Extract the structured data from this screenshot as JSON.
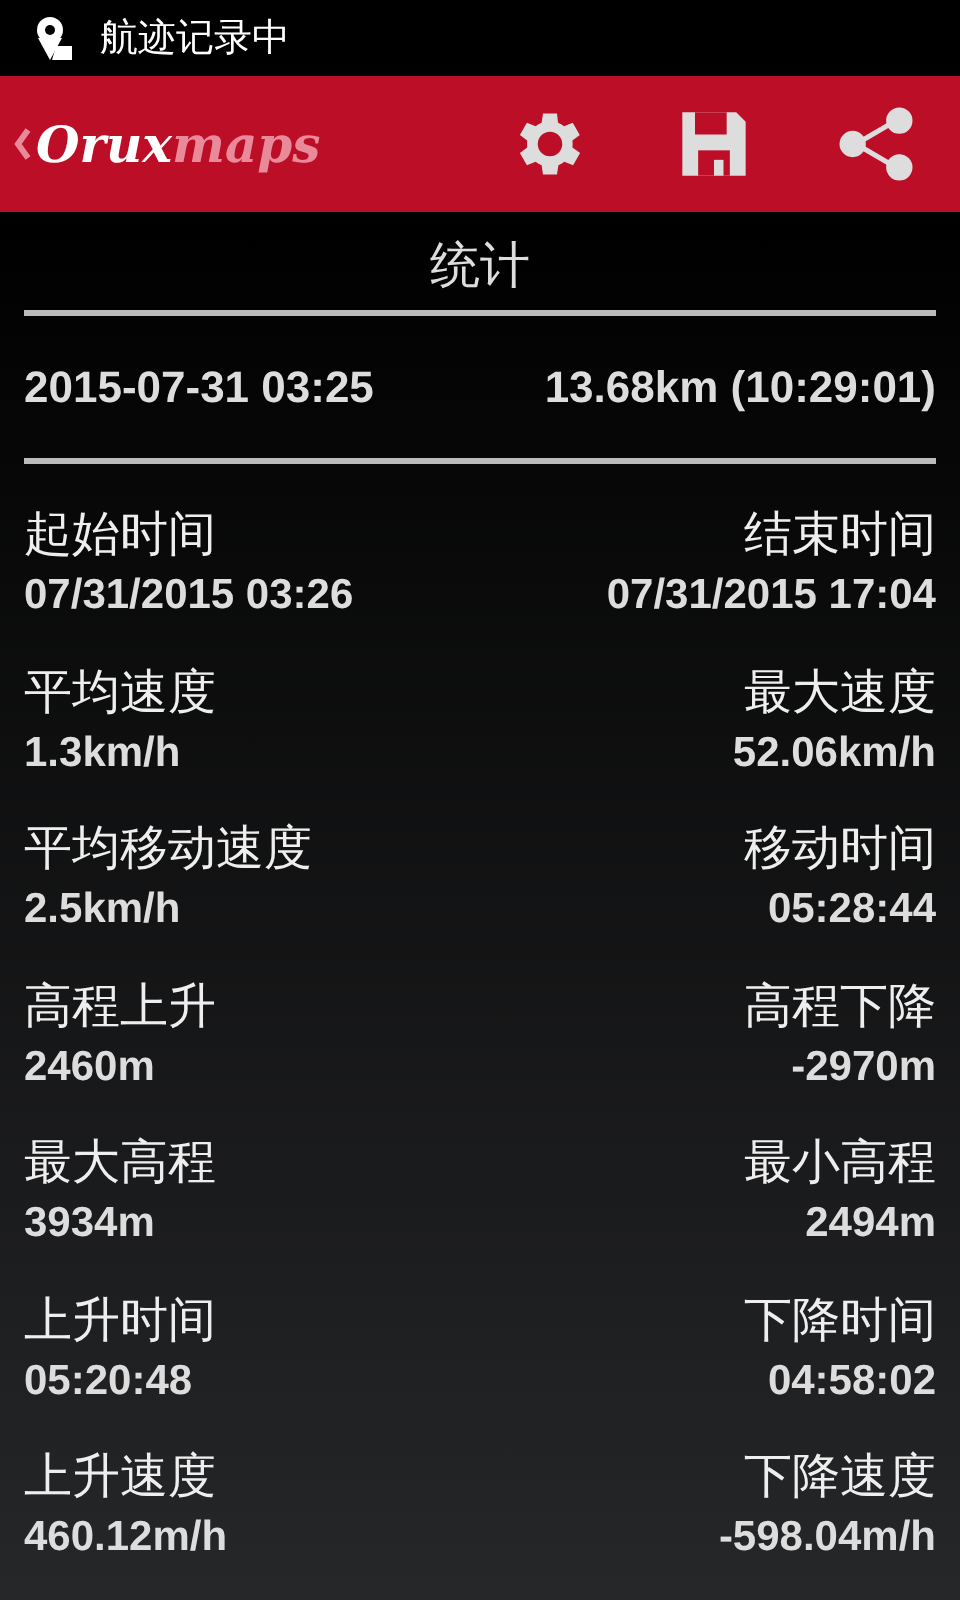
{
  "status_bar": {
    "text": "航迹记录中"
  },
  "app_bar": {
    "logo_primary": "Orux",
    "logo_secondary": "maps"
  },
  "title": "统计",
  "summary": {
    "date": "2015-07-31 03:25",
    "distance": "13.68km (10:29:01)"
  },
  "stats": [
    {
      "left": {
        "label": "起始时间",
        "value": "07/31/2015 03:26"
      },
      "right": {
        "label": "结束时间",
        "value": "07/31/2015 17:04"
      }
    },
    {
      "left": {
        "label": "平均速度",
        "value": "1.3km/h"
      },
      "right": {
        "label": "最大速度",
        "value": "52.06km/h"
      }
    },
    {
      "left": {
        "label": "平均移动速度",
        "value": "2.5km/h"
      },
      "right": {
        "label": "移动时间",
        "value": "05:28:44"
      }
    },
    {
      "left": {
        "label": "高程上升",
        "value": "2460m"
      },
      "right": {
        "label": "高程下降",
        "value": "-2970m"
      }
    },
    {
      "left": {
        "label": "最大高程",
        "value": "3934m"
      },
      "right": {
        "label": "最小高程",
        "value": "2494m"
      }
    },
    {
      "left": {
        "label": "上升时间",
        "value": "05:20:48"
      },
      "right": {
        "label": "下降时间",
        "value": "04:58:02"
      }
    },
    {
      "left": {
        "label": "上升速度",
        "value": "460.12m/h"
      },
      "right": {
        "label": "下降速度",
        "value": "-598.04m/h"
      }
    }
  ]
}
